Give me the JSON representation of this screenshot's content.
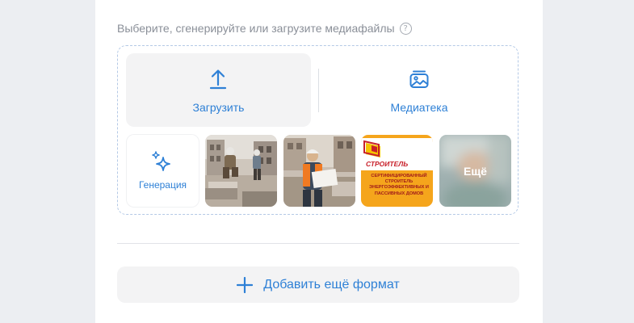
{
  "media_picker": {
    "caption": "Выберите, сгенерируйте или загрузите медиафайлы",
    "help_symbol": "?",
    "upload_label": "Загрузить",
    "library_label": "Медиатека",
    "generate_label": "Генерация",
    "more_label": "Ещё",
    "thumbnails": [
      {
        "icon": "workers-photo"
      },
      {
        "icon": "engineer-photo"
      },
      {
        "icon": "builder-banner",
        "title": "СТРОИТЕЛЬ",
        "text": "СЕРТИФИЦИРОВАННЫЙ СТРОИТЕЛЬ ЭНЕРГОЭФФЕКТИВНЫХ И ПАССИВНЫХ ДОМОВ"
      }
    ]
  },
  "footer": {
    "add_format_label": "Добавить ещё формат"
  },
  "colors": {
    "accent": "#2e80d6",
    "tile_bg": "#f3f3f4",
    "page_bg": "#eceef2"
  }
}
